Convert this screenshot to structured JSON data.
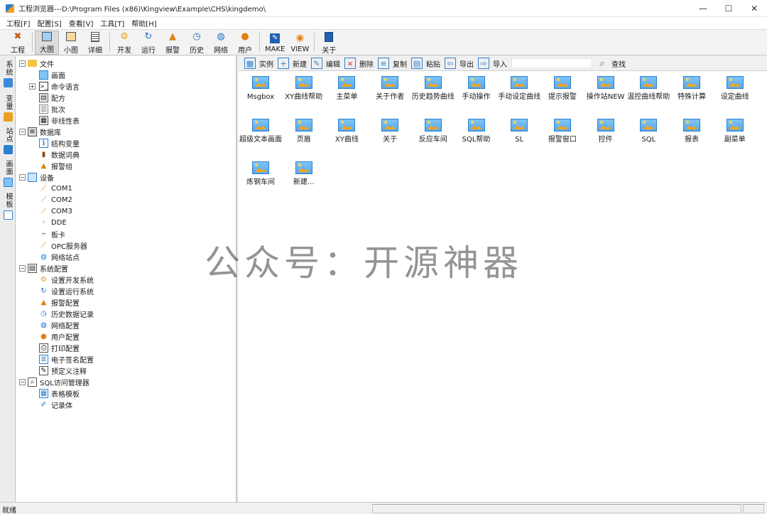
{
  "window": {
    "title": "工程浏览器---D:\\Program Files (x86)\\Kingview\\Example\\CHS\\kingdemo\\",
    "minimize": "—",
    "maximize": "☐",
    "close": "✕"
  },
  "menu": [
    "工程[F]",
    "配置[S]",
    "查看[V]",
    "工具[T]",
    "帮助[H]"
  ],
  "toolbar": {
    "project": "工程",
    "large": "大图",
    "small": "小图",
    "detail": "详细",
    "develop": "开发",
    "run": "运行",
    "alarm": "报警",
    "history": "历史",
    "network": "网络",
    "user": "用户",
    "make": "MAKE",
    "view": "VIEW",
    "about": "关于"
  },
  "side_tabs": [
    "系统",
    "变量",
    "站点",
    "画面",
    "模板"
  ],
  "tree": {
    "file": "文件",
    "screen": "画面",
    "command_lang": "命令语言",
    "recipe": "配方",
    "batch": "批次",
    "nonlinear": "非线性表",
    "database": "数据库",
    "struct_var": "结构变量",
    "data_dict": "数据词典",
    "alarm_group": "报警组",
    "device": "设备",
    "com1": "COM1",
    "com2": "COM2",
    "com3": "COM3",
    "dde": "DDE",
    "board": "板卡",
    "opc": "OPC服务器",
    "net_station": "网络站点",
    "sys_config": "系统配置",
    "set_dev": "设置开发系统",
    "set_run": "设置运行系统",
    "alarm_config": "报警配置",
    "history_log": "历史数据记录",
    "net_config": "网络配置",
    "user_config": "用户配置",
    "print_config": "打印配置",
    "esign_config": "电子签名配置",
    "custom_note": "预定义注释",
    "sql_mgr": "SQL访问管理器",
    "table_tpl": "表格模板",
    "record": "记录体"
  },
  "content_toolbar": {
    "instance": "实例",
    "new": "新建",
    "edit": "编辑",
    "delete": "删除",
    "copy": "复制",
    "paste": "粘贴",
    "export": "导出",
    "import": "导入",
    "search_value": "",
    "find": "查找"
  },
  "screens": [
    "Msgbox",
    "XY曲线帮助",
    "主菜单",
    "关于作者",
    "历史趋势曲线",
    "手动操作",
    "手动设定曲线",
    "提示报警",
    "操作站NEW",
    "温控曲线帮助",
    "特殊计算",
    "设定曲线",
    "超级文本画面",
    "页眉",
    "XY曲线",
    "关于",
    "反应车间",
    "SQL帮助",
    "SL",
    "报警窗口",
    "控件",
    "SQL",
    "报表",
    "副菜单",
    "炼钢车间",
    "新建..."
  ],
  "watermark": "公众号：开源神器",
  "status": "就绪",
  "icons": {
    "app": "kingview-app-icon",
    "folder": "folder-icon",
    "picture": "picture-icon",
    "search": "magnifier-icon"
  },
  "colors": {
    "accent": "#2d7fcf",
    "folder": "#f4c542",
    "picture_bg": "#7fc4f7",
    "picture_mountain": "#f4a41e"
  }
}
